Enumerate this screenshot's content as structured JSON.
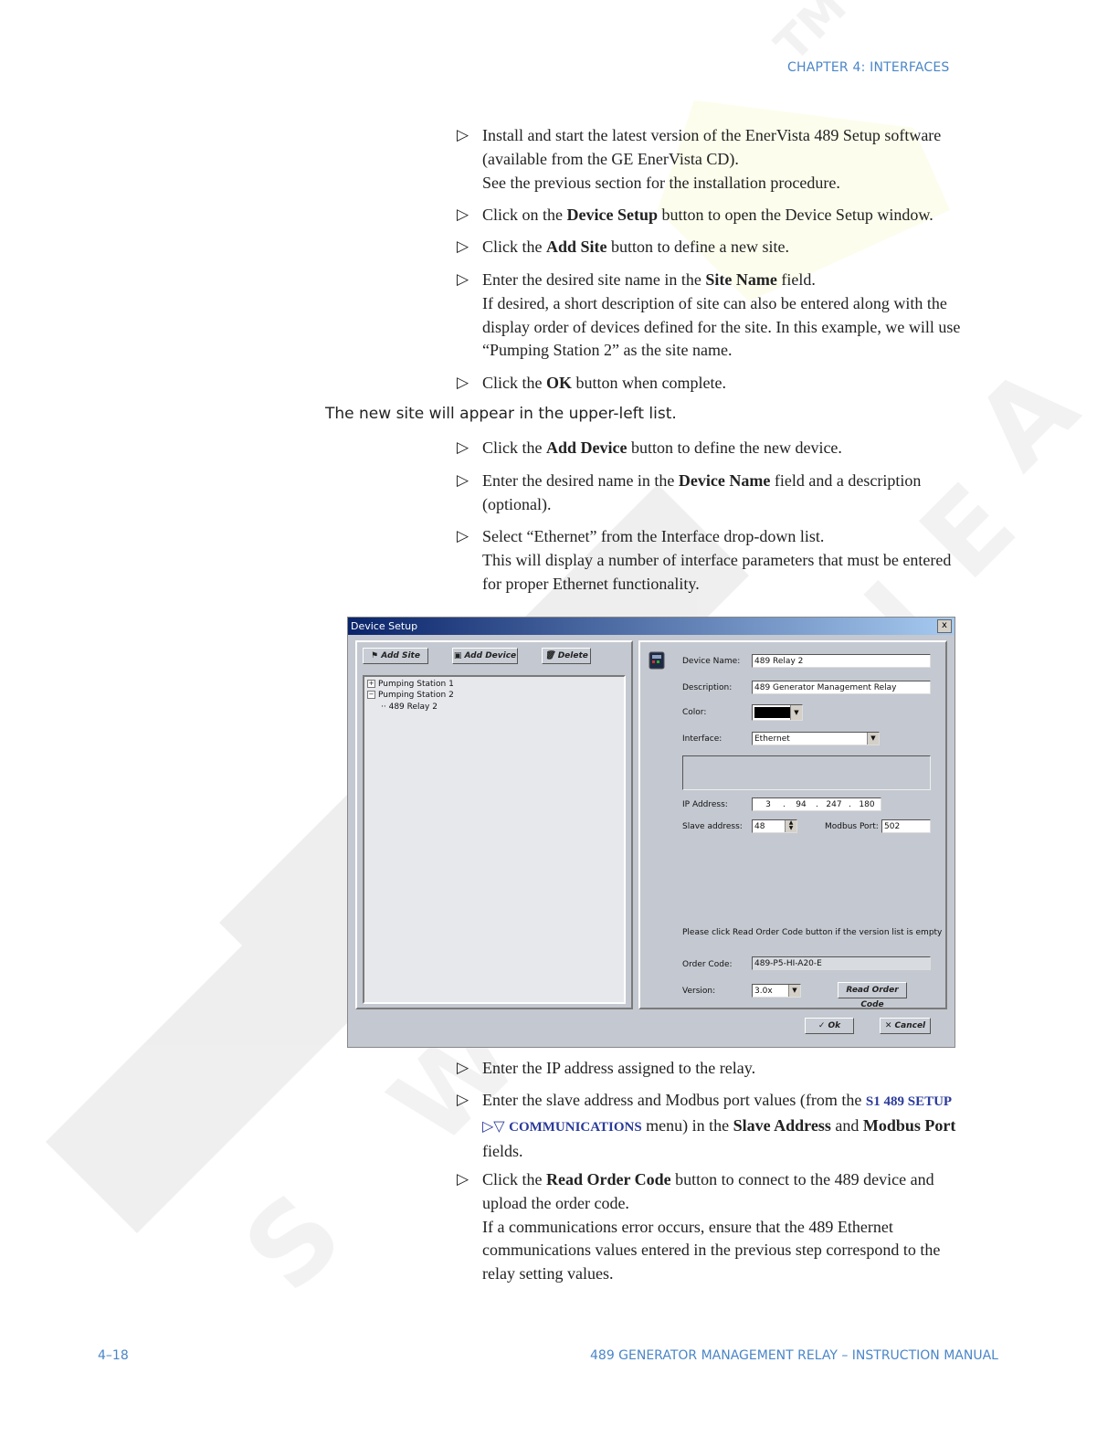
{
  "header": {
    "chapter": "CHAPTER 4: INTERFACES"
  },
  "steps_top": [
    {
      "line1": "Install and start the latest version of the EnerVista 489 Setup software",
      "line2": "(available from the GE EnerVista CD).",
      "line3": "See the previous section for the installation procedure."
    },
    {
      "pre": "Click on the ",
      "bold": "Device Setup",
      "post": " button to open the Device Setup window."
    },
    {
      "pre": "Click the ",
      "bold": "Add Site",
      "post": " button to define a new site."
    },
    {
      "pre": "Enter the desired site name in the ",
      "bold": "Site Name",
      "post": " field.",
      "line2": "If desired, a short description of site can also be entered along with the",
      "line3": "display order of devices defined for the site. In this example, we will use",
      "line4": "“Pumping Station 2” as the site name."
    },
    {
      "pre": "Click the ",
      "bold": "OK",
      "post": " button when complete."
    }
  ],
  "note": "The new site will appear in the upper-left list.",
  "steps_mid": [
    {
      "pre": "Click the ",
      "bold": "Add Device",
      "post": " button to define the new device."
    },
    {
      "pre": "Enter the desired name in the ",
      "bold": "Device Name",
      "post": " field and a description",
      "line2": "(optional)."
    },
    {
      "line1": "Select “Ethernet” from the Interface drop-down list.",
      "line2": "This will display a number of interface parameters that must be entered",
      "line3": "for proper Ethernet functionality."
    }
  ],
  "dialog": {
    "title": "Device Setup",
    "close": "x",
    "add_site": "Add Site",
    "add_device": "Add Device",
    "delete": "Delete",
    "tree": [
      "Pumping Station 1",
      "Pumping Station 2",
      "489 Relay 2"
    ],
    "device_name_label": "Device Name:",
    "device_name": "489 Relay 2",
    "description_label": "Description:",
    "description": "489 Generator Management Relay",
    "color_label": "Color:",
    "color_value": "#000000",
    "interface_label": "Interface:",
    "interface": "Ethernet",
    "ip_label": "IP Address:",
    "ip": [
      "3",
      "94",
      "247",
      "180"
    ],
    "slave_label": "Slave address:",
    "slave": "48",
    "modbus_label": "Modbus Port:",
    "modbus": "502",
    "hint": "Please click Read Order Code button if the version list is empty",
    "order_code_label": "Order Code:",
    "order_code": "489-P5-HI-A20-E",
    "version_label": "Version:",
    "version": "3.0x",
    "read_order_code": "Read Order Code",
    "ok": "Ok",
    "cancel": "Cancel"
  },
  "steps_bottom": [
    {
      "line1": "Enter the IP address assigned to the relay."
    },
    {
      "pre": "Enter the slave address and Modbus port values (from the ",
      "menu1": "S1 489 SETUP",
      "menu_sym": "▷▽",
      "menu2": "COMMUNICATIONS",
      "post": " menu) in the ",
      "bold1": "Slave Address",
      "and": " and ",
      "bold2": "Modbus Port",
      "line3": "fields."
    },
    {
      "pre": "Click the ",
      "bold": "Read Order Code",
      "post": " button to connect to the 489 device and",
      "line2": "upload the order code.",
      "line3": "If a communications error occurs, ensure that the 489 Ethernet",
      "line4": "communications values entered in the previous step correspond to the",
      "line5": "relay setting values."
    }
  ],
  "footer": {
    "page": "4–18",
    "manual": "489 GENERATOR MANAGEMENT RELAY – INSTRUCTION MANUAL"
  },
  "watermark": {
    "text": "NAW SWITCHGEAR"
  }
}
